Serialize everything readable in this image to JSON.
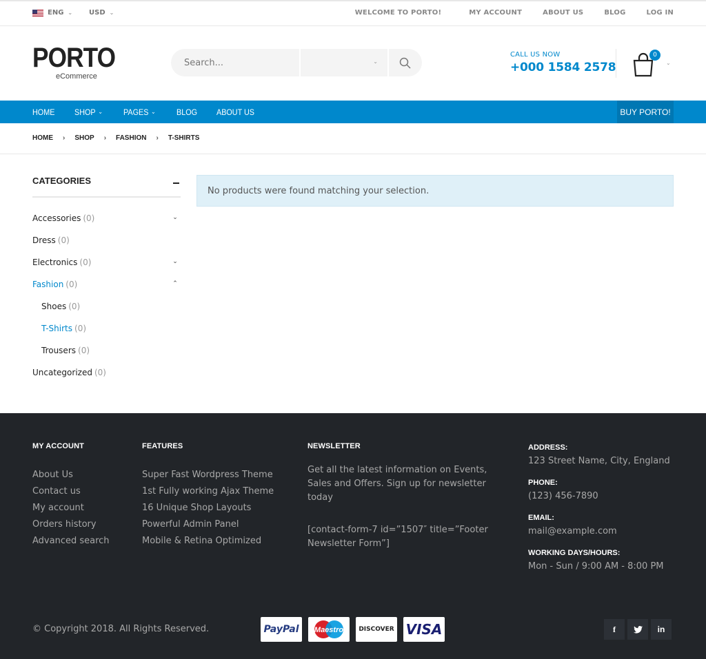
{
  "topbar": {
    "language": "ENG",
    "currency": "USD",
    "welcome": "WELCOME TO PORTO!",
    "links": [
      "MY ACCOUNT",
      "ABOUT US",
      "BLOG",
      "LOG IN"
    ]
  },
  "header": {
    "logo_word": "PORTO",
    "logo_sub": "eCommerce",
    "search_placeholder": "Search...",
    "call_label": "CALL US NOW",
    "phone": "+000 1584 2578",
    "cart_count": "0"
  },
  "nav": {
    "items": [
      {
        "label": "HOME",
        "has_dropdown": false
      },
      {
        "label": "SHOP",
        "has_dropdown": true
      },
      {
        "label": "PAGES",
        "has_dropdown": true
      },
      {
        "label": "BLOG",
        "has_dropdown": false
      },
      {
        "label": "ABOUT US",
        "has_dropdown": false
      }
    ],
    "buy_label": "BUY PORTO!"
  },
  "breadcrumb": [
    "HOME",
    "SHOP",
    "FASHION",
    "T-SHIRTS"
  ],
  "sidebar": {
    "title": "CATEGORIES",
    "categories": [
      {
        "name": "Accessories",
        "count": "(0)",
        "toggle": "down",
        "child": false,
        "active": false
      },
      {
        "name": "Dress",
        "count": "(0)",
        "toggle": "",
        "child": false,
        "active": false
      },
      {
        "name": "Electronics",
        "count": "(0)",
        "toggle": "down",
        "child": false,
        "active": false
      },
      {
        "name": "Fashion",
        "count": "(0)",
        "toggle": "up",
        "child": false,
        "active": true
      },
      {
        "name": "Shoes",
        "count": "(0)",
        "toggle": "",
        "child": true,
        "active": false
      },
      {
        "name": "T-Shirts",
        "count": "(0)",
        "toggle": "",
        "child": true,
        "active": true
      },
      {
        "name": "Trousers",
        "count": "(0)",
        "toggle": "",
        "child": true,
        "active": false
      },
      {
        "name": "Uncategorized",
        "count": "(0)",
        "toggle": "",
        "child": false,
        "active": false
      }
    ]
  },
  "main": {
    "notice": "No products were found matching your selection."
  },
  "footer": {
    "my_account": {
      "title": "MY ACCOUNT",
      "links": [
        "About Us",
        "Contact us",
        "My account",
        "Orders history",
        "Advanced search"
      ]
    },
    "features": {
      "title": "FEATURES",
      "links": [
        "Super Fast Wordpress Theme",
        "1st Fully working Ajax Theme",
        "16 Unique Shop Layouts",
        "Powerful Admin Panel",
        "Mobile & Retina Optimized"
      ]
    },
    "newsletter": {
      "title": "NEWSLETTER",
      "text": "Get all the latest information on Events, Sales and Offers. Sign up for newsletter today",
      "shortcode": "[contact-form-7 id=”1507″ title=”Footer Newsletter Form”]"
    },
    "contact": {
      "address_label": "ADDRESS:",
      "address": "123 Street Name, City, England",
      "phone_label": "PHONE:",
      "phone": "(123) 456-7890",
      "email_label": "EMAIL:",
      "email": "mail@example.com",
      "hours_label": "WORKING DAYS/HOURS:",
      "hours": "Mon - Sun / 9:00 AM - 8:00 PM"
    },
    "copyright": "© Copyright 2018. All Rights Reserved.",
    "payments": [
      "PayPal",
      "Maestro",
      "DISCOVER",
      "VISA"
    ],
    "social": [
      "facebook-icon",
      "twitter-icon",
      "linkedin-icon"
    ]
  },
  "colors": {
    "accent": "#0088cc",
    "footer_bg": "#222529"
  }
}
